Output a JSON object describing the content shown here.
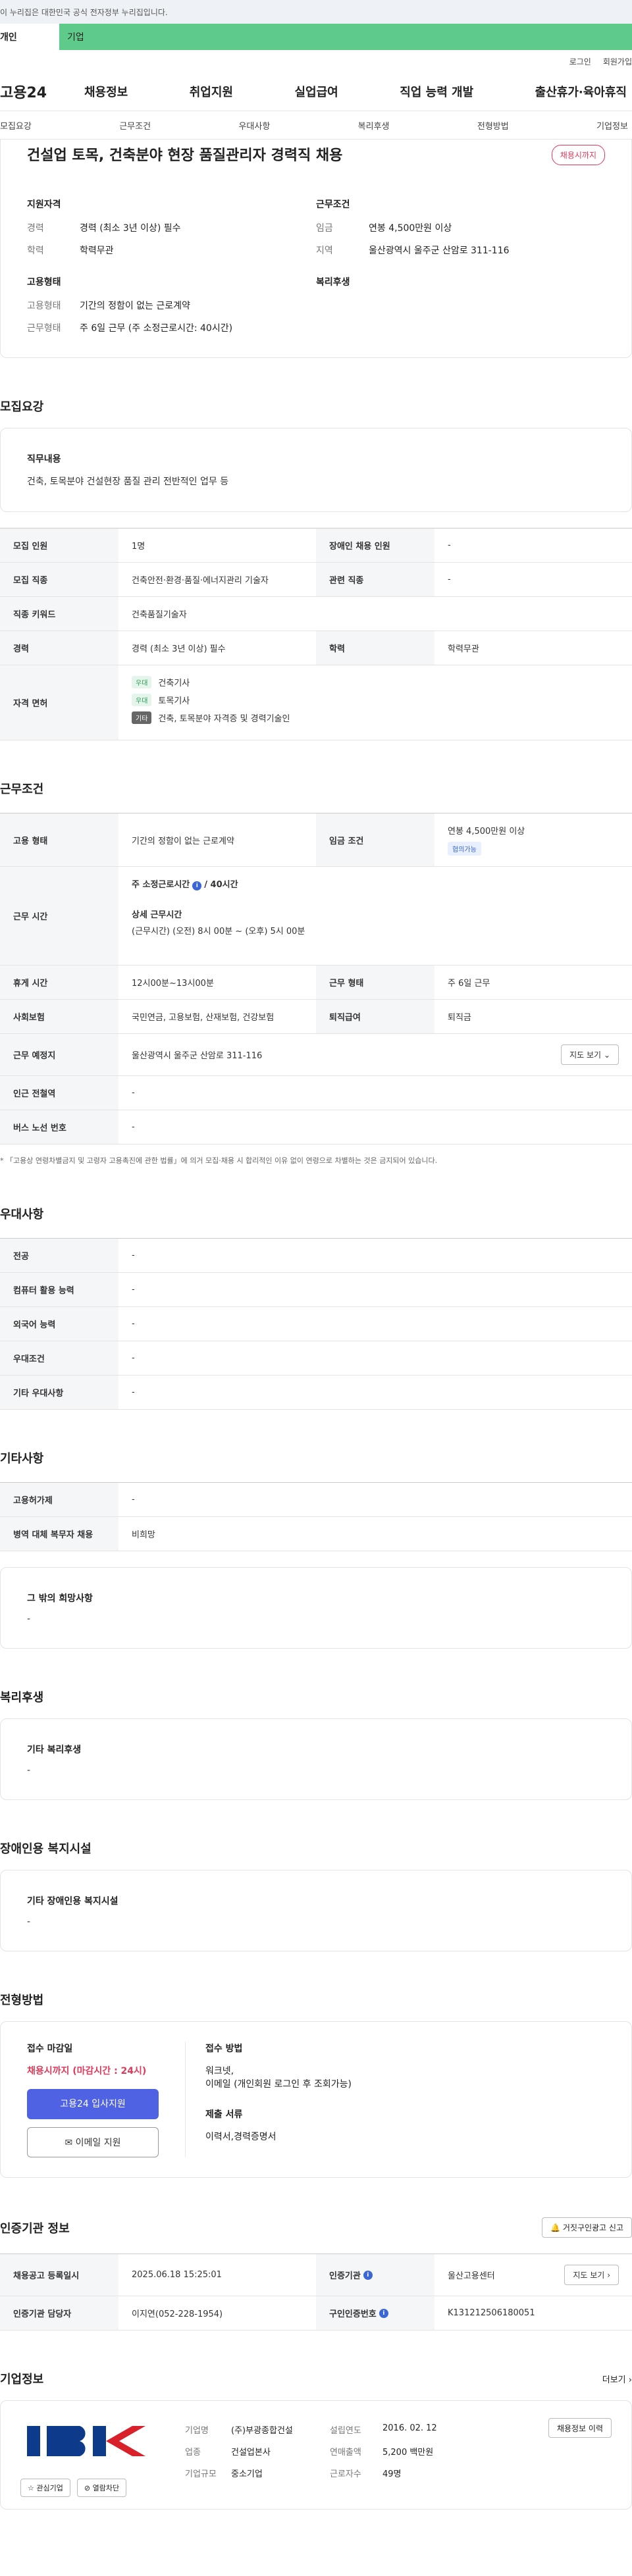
{
  "top_banner": "이 누리집은 대한민국 공식 전자정부 누리집입니다.",
  "tabs": {
    "personal": "개인",
    "company": "기업"
  },
  "util": {
    "login": "로그인",
    "join": "회원가입"
  },
  "gnb": {
    "logo": "고용24",
    "menu": [
      "채용정보",
      "취업지원",
      "실업급여",
      "직업 능력 개발",
      "출산휴가·육아휴직"
    ]
  },
  "subtabs": [
    "모집요강",
    "근무조건",
    "우대사항",
    "복리후생",
    "전형방법",
    "기업정보"
  ],
  "summary": {
    "title": "건설업 토목, 건축분야 현장 품질관리자 경력직 채용",
    "badge": "채용시까지",
    "qual_title": "지원자격",
    "career_k": "경력",
    "career_v": "경력 (최소 3년 이상) 필수",
    "edu_k": "학력",
    "edu_v": "학력무관",
    "cond_title": "근무조건",
    "wage_k": "임금",
    "wage_v": "연봉 4,500만원 이상",
    "loc_k": "지역",
    "loc_v": "울산광역시 울주군 산암로 311-116",
    "emp_title": "고용형태",
    "emptype_k": "고용형태",
    "emptype_v": "기간의 정함이 없는 근로계약",
    "worktype_k": "근무형태",
    "worktype_v": "주 6일 근무 (주 소정근로시간: 40시간)",
    "welfare_title": "복리후생"
  },
  "recruit": {
    "title": "모집요강",
    "duty_title": "직무내용",
    "duty_text": "건축, 토목분야 건설현장 품질 관리 전반적인 업무 등",
    "rows": {
      "count_k": "모집 인원",
      "count_v": "1명",
      "disabled_k": "장애인 채용 인원",
      "disabled_v": "-",
      "job_k": "모집 직종",
      "job_v": "건축안전·환경·품질·에너지관리 기술자",
      "related_k": "관련 직종",
      "related_v": "-",
      "keyword_k": "직종 키워드",
      "keyword_v": "건축품질기술자",
      "career_k": "경력",
      "career_v": "경력 (최소 3년 이상) 필수",
      "edu_k": "학력",
      "edu_v": "학력무관",
      "license_k": "자격 면허"
    },
    "licenses": [
      {
        "chip": "우대",
        "name": "건축기사"
      },
      {
        "chip": "우대",
        "name": "토목기사"
      },
      {
        "chip": "기타",
        "name": "건축, 토목분야 자격증 및 경력기술인"
      }
    ]
  },
  "work": {
    "title": "근무조건",
    "emptype_k": "고용 형태",
    "emptype_v": "기간의 정함이 없는 근로계약",
    "wage_k": "임금 조건",
    "wage_v": "연봉 4,500만원 이상",
    "wage_chip": "협의가능",
    "hours_k": "근무 시간",
    "hours_week": "주 소정근로시간",
    "hours_week_v": "/ 40시간",
    "hours_detail_title": "상세 근무시간",
    "hours_detail": "(근무시간) (오전) 8시 00분 ~ (오후) 5시 00분",
    "break_k": "휴게 시간",
    "break_v": "12시00분~13시00분",
    "form_k": "근무 형태",
    "form_v": "주 6일 근무",
    "insurance_k": "사회보험",
    "insurance_v": "국민연금, 고용보험, 산재보험, 건강보험",
    "severance_k": "퇴직급여",
    "severance_v": "퇴직금",
    "place_k": "근무 예정지",
    "place_v": "울산광역시 울주군 산암로 311-116",
    "map_btn": "지도 보기",
    "subway_k": "인근 전철역",
    "subway_v": "-",
    "bus_k": "버스 노선 번호",
    "bus_v": "-",
    "note": "* 「고용상 연령차별금지 및 고령자 고용촉진에 관한 법률」에 의거 모집·채용 시 합리적인 이유 없이 연령으로 차별하는 것은 금지되어 있습니다."
  },
  "prefer": {
    "title": "우대사항",
    "rows": [
      {
        "k": "전공",
        "v": "-"
      },
      {
        "k": "컴퓨터 활용 능력",
        "v": "-"
      },
      {
        "k": "외국어 능력",
        "v": "-"
      },
      {
        "k": "우대조건",
        "v": "-"
      },
      {
        "k": "기타 우대사항",
        "v": "-"
      }
    ]
  },
  "etc": {
    "title": "기타사항",
    "rows": [
      {
        "k": "고용허가제",
        "v": "-"
      },
      {
        "k": "병역 대체 복무자 채용",
        "v": "비희망"
      }
    ],
    "other_title": "그 밖의 희망사항",
    "other_v": "-"
  },
  "welfare": {
    "title": "복리후생",
    "box_title": "기타 복리후생",
    "box_v": "-"
  },
  "disabled_fac": {
    "title": "장애인용 복지시설",
    "box_title": "기타 장애인용 복지시설",
    "box_v": "-"
  },
  "apply": {
    "title": "전형방법",
    "deadline_title": "접수 마감일",
    "deadline": "채용시까지 (마감시간 : 24시)",
    "btn_apply": "고용24 입사지원",
    "btn_email": "이메일 지원",
    "method_title": "접수 방법",
    "method_1": "워크넷,",
    "method_2": "이메일 (개인회원 로그인 후 조회가능)",
    "docs_title": "제출 서류",
    "docs": "이력서,경력증명서"
  },
  "cert": {
    "title": "인증기관 정보",
    "report_btn": "거짓구인광고 신고",
    "reg_k": "채용공고 등록일시",
    "reg_v": "2025.06.18 15:25:01",
    "agency_k": "인증기관",
    "agency_v": "울산고용센터",
    "map_btn": "지도 보기",
    "manager_k": "인증기관 담당자",
    "manager_v": "이지연(052-228-1954)",
    "ad_k": "구인인증번호",
    "ad_v": "K131212506180051"
  },
  "company": {
    "title": "기업정보",
    "more": "더보기",
    "logo_text": "IBK",
    "name_k": "기업명",
    "name_v": "(주)부광종합건설",
    "est_k": "설립연도",
    "est_v": "2016. 02. 12",
    "hist_btn": "채용정보 이력",
    "ind_k": "업종",
    "ind_v": "건설업본사",
    "rev_k": "연매출액",
    "rev_v": "5,200 백만원",
    "size_k": "기업규모",
    "size_v": "중소기업",
    "emp_k": "근로자수",
    "emp_v": "49명",
    "fav_btn": "관심기업",
    "block_btn": "열람차단"
  },
  "colors": {
    "accent": "#4f62e3",
    "danger": "#e0395a",
    "brand_green": "#5ecb8b"
  }
}
